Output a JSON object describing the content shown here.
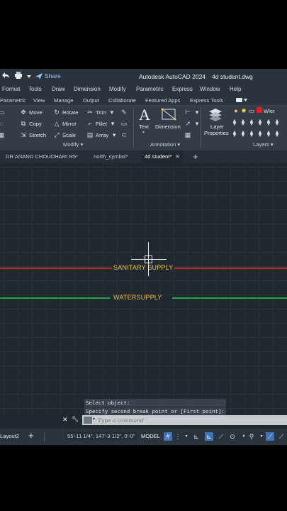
{
  "titlebar": {
    "share_label": "Share",
    "app_title": "Autodesk AutoCAD 2024",
    "file_title": "4d student.dwg"
  },
  "menu": [
    "Format",
    "Tools",
    "Draw",
    "Dimension",
    "Modify",
    "Parametric",
    "Express",
    "Window",
    "Help"
  ],
  "ribbon_tabs": [
    "Parametric",
    "View",
    "Manage",
    "Output",
    "Collaborate",
    "Featured Apps",
    "Express Tools"
  ],
  "ribbon": {
    "modify": {
      "move": "Move",
      "rotate": "Rotate",
      "trim": "Trim",
      "copy": "Copy",
      "mirror": "Mirror",
      "fillet": "Fillet",
      "stretch": "Stretch",
      "scale": "Scale",
      "array": "Array",
      "panel_label": "Modify ▾"
    },
    "annotation": {
      "text": "Text",
      "dimension": "Dimension",
      "panel_label": "Annotation ▾"
    },
    "layers": {
      "layer_properties_1": "Layer",
      "layer_properties_2": "Properties",
      "current_layer": "Wier",
      "current_layer_color": "#e02020",
      "panel_label": "Layers ▾"
    }
  },
  "file_tabs": {
    "tab1": "DR ANAND CHOUDHARI R5*",
    "tab2": "north_symbol*",
    "tab3": "4d student*"
  },
  "drawing": {
    "line1_label": "SANITARY SUPPLY",
    "line1_color": "#c0282b",
    "line2_label": "WATERSUPPLY",
    "line2_color": "#23a34a",
    "label_color": "#e9c548"
  },
  "command": {
    "history1": "Select object:",
    "history2": "Specify second break point or [First point]:",
    "placeholder": "Type a command"
  },
  "statusbar": {
    "layout_tab": "Layout2",
    "coordinates": "55'-11 1/4\", 147'-3 1/2\", 0'-0\"",
    "model": "MODEL"
  }
}
